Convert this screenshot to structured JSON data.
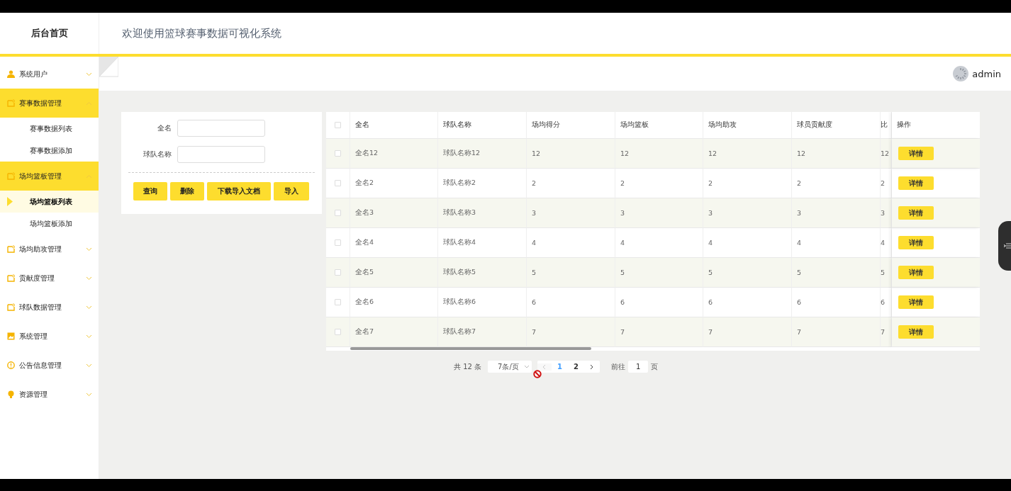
{
  "header": {
    "brand": "后台首页",
    "title": "欢迎使用篮球赛事数据可视化系统"
  },
  "user": {
    "name": "admin"
  },
  "sidebar": {
    "items": [
      {
        "label": "系统用户",
        "expanded": false
      },
      {
        "label": "赛事数据管理",
        "expanded": true,
        "children": [
          {
            "label": "赛事数据列表",
            "selected": false
          },
          {
            "label": "赛事数据添加",
            "selected": false
          }
        ]
      },
      {
        "label": "场均篮板管理",
        "expanded": true,
        "children": [
          {
            "label": "场均篮板列表",
            "selected": true
          },
          {
            "label": "场均篮板添加",
            "selected": false
          }
        ]
      },
      {
        "label": "场均助攻管理",
        "expanded": false
      },
      {
        "label": "贡献度管理",
        "expanded": false
      },
      {
        "label": "球队数据管理",
        "expanded": false
      },
      {
        "label": "系统管理",
        "expanded": false
      },
      {
        "label": "公告信息管理",
        "expanded": false
      },
      {
        "label": "资源管理",
        "expanded": false
      }
    ]
  },
  "search": {
    "fields": [
      {
        "label": "全名"
      },
      {
        "label": "球队名称"
      }
    ],
    "buttons": [
      "查询",
      "删除",
      "下载导入文档",
      "导入"
    ]
  },
  "table": {
    "select_all_checked": false,
    "columns": [
      "全名",
      "球队名称",
      "场均得分",
      "场均篮板",
      "场均助攻",
      "球员贡献度",
      "比",
      "操作"
    ],
    "rows": [
      {
        "checked": false,
        "cells": [
          "全名12",
          "球队名称12",
          "12",
          "12",
          "12",
          "12",
          "12"
        ],
        "action": "详情"
      },
      {
        "checked": false,
        "cells": [
          "全名2",
          "球队名称2",
          "2",
          "2",
          "2",
          "2",
          "2"
        ],
        "action": "详情"
      },
      {
        "checked": false,
        "cells": [
          "全名3",
          "球队名称3",
          "3",
          "3",
          "3",
          "3",
          "3"
        ],
        "action": "详情"
      },
      {
        "checked": false,
        "cells": [
          "全名4",
          "球队名称4",
          "4",
          "4",
          "4",
          "4",
          "4"
        ],
        "action": "详情"
      },
      {
        "checked": false,
        "cells": [
          "全名5",
          "球队名称5",
          "5",
          "5",
          "5",
          "5",
          "5"
        ],
        "action": "详情"
      },
      {
        "checked": false,
        "cells": [
          "全名6",
          "球队名称6",
          "6",
          "6",
          "6",
          "6",
          "6"
        ],
        "action": "详情"
      },
      {
        "checked": false,
        "cells": [
          "全名7",
          "球队名称7",
          "7",
          "7",
          "7",
          "7",
          "7"
        ],
        "action": "详情"
      }
    ]
  },
  "pagination": {
    "total": "共 12 条",
    "page_size": "7条/页",
    "pages": [
      {
        "label": "1",
        "selected": true
      },
      {
        "label": "2",
        "selected": false
      }
    ],
    "goto_label": "前往",
    "goto_value": "1",
    "goto_suffix": "页"
  }
}
